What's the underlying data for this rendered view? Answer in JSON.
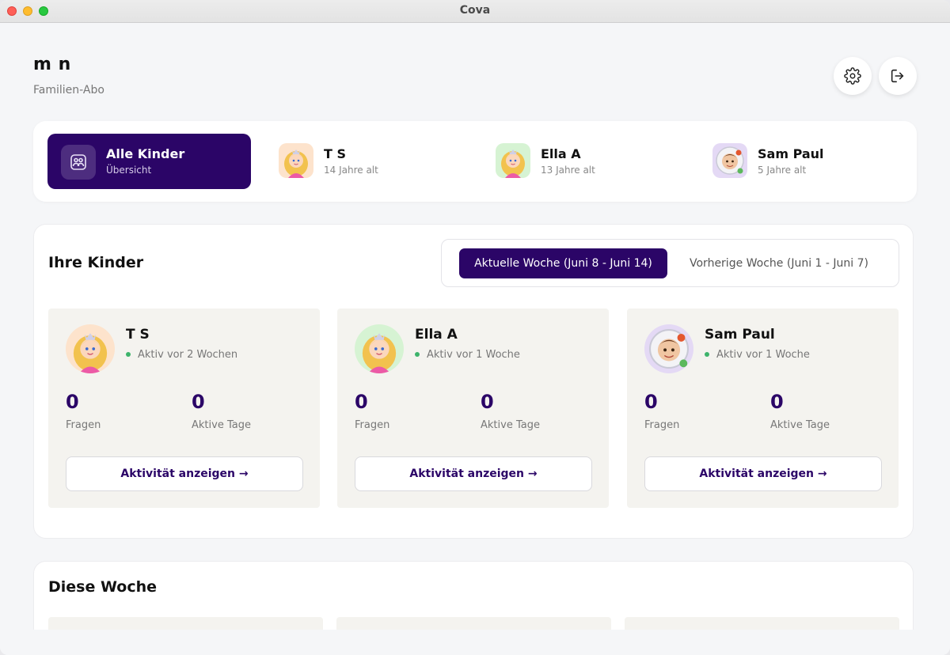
{
  "window": {
    "title": "Cova"
  },
  "header": {
    "user_name": "m n",
    "plan": "Familien-Abo",
    "settings_icon": "gear-icon",
    "logout_icon": "logout-icon"
  },
  "selector": {
    "all": {
      "title": "Alle Kinder",
      "subtitle": "Übersicht",
      "icon": "family-icon"
    },
    "children": [
      {
        "name": "T S",
        "age": "14 Jahre alt",
        "avatar_bg": "#fde3cc"
      },
      {
        "name": "Ella A",
        "age": "13 Jahre alt",
        "avatar_bg": "#d6f3d3"
      },
      {
        "name": "Sam Paul",
        "age": "5 Jahre alt",
        "avatar_bg": "#e4d9f5"
      }
    ]
  },
  "kids_section": {
    "title": "Ihre Kinder",
    "week_current": "Aktuelle Woche (Juni 8 - Juni 14)",
    "week_previous": "Vorherige Woche (Juni 1 - Juni 7)",
    "cards": [
      {
        "name": "T S",
        "status": "Aktiv vor 2 Wochen",
        "questions": "0",
        "questions_label": "Fragen",
        "active_days": "0",
        "active_days_label": "Aktive Tage",
        "button": "Aktivität anzeigen →"
      },
      {
        "name": "Ella A",
        "status": "Aktiv vor 1 Woche",
        "questions": "0",
        "questions_label": "Fragen",
        "active_days": "0",
        "active_days_label": "Aktive Tage",
        "button": "Aktivität anzeigen →"
      },
      {
        "name": "Sam Paul",
        "status": "Aktiv vor 1 Woche",
        "questions": "0",
        "questions_label": "Fragen",
        "active_days": "0",
        "active_days_label": "Aktive Tage",
        "button": "Aktivität anzeigen →"
      }
    ]
  },
  "week_section": {
    "title": "Diese Woche"
  },
  "colors": {
    "accent": "#2b0567",
    "status_dot": "#3db36b",
    "card_bg": "#f4f3ef"
  }
}
